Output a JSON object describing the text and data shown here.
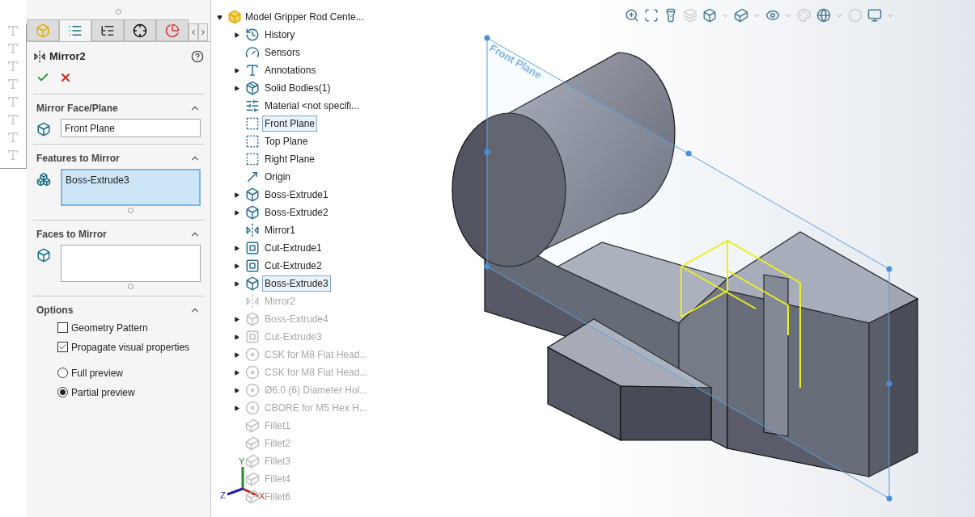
{
  "property_manager": {
    "tabs": [
      {
        "kind": "part",
        "selected": false
      },
      {
        "kind": "properties",
        "selected": true
      },
      {
        "kind": "configurations",
        "selected": false
      },
      {
        "kind": "dimensions",
        "selected": false
      },
      {
        "kind": "appearance",
        "selected": false
      }
    ],
    "title": "Mirror2",
    "sections": [
      {
        "title": "Mirror Face/Plane",
        "expanded": true,
        "kind": "plane",
        "value": "Front Plane",
        "active": false
      },
      {
        "title": "Features to Mirror",
        "expanded": true,
        "kind": "features",
        "value": "Boss-Extrude3",
        "active": true
      },
      {
        "title": "Faces to Mirror",
        "expanded": true,
        "kind": "faces",
        "active": false
      }
    ],
    "options": {
      "title": "Options",
      "expanded": true,
      "checkboxes": [
        {
          "label": "Geometry Pattern",
          "checked": false
        },
        {
          "label": "Propagate visual properties",
          "checked": true
        }
      ],
      "radios": [
        {
          "label": "Full preview",
          "selected": false
        },
        {
          "label": "Partial preview",
          "selected": true
        }
      ]
    }
  },
  "feature_tree": {
    "label": "Model Gripper Rod Cente...",
    "expanded": true,
    "children": [
      {
        "label": "History",
        "kind": "history",
        "expandable": true,
        "selected": false,
        "greyed": false
      },
      {
        "label": "Sensors",
        "kind": "sensors",
        "expandable": false,
        "selected": false,
        "greyed": false
      },
      {
        "label": "Annotations",
        "kind": "annotations",
        "expandable": true,
        "selected": false,
        "greyed": false
      },
      {
        "label": "Solid Bodies(1)",
        "kind": "bodies",
        "expandable": true,
        "selected": false,
        "greyed": false
      },
      {
        "label": "Material <not specifi...",
        "kind": "material",
        "expandable": false,
        "selected": false,
        "greyed": false
      },
      {
        "label": "Front Plane",
        "kind": "plane",
        "expandable": false,
        "selected": true,
        "greyed": false
      },
      {
        "label": "Top Plane",
        "kind": "plane",
        "expandable": false,
        "selected": false,
        "greyed": false
      },
      {
        "label": "Right Plane",
        "kind": "plane",
        "expandable": false,
        "selected": false,
        "greyed": false
      },
      {
        "label": "Origin",
        "kind": "origin",
        "expandable": false,
        "selected": false,
        "greyed": false
      },
      {
        "label": "Boss-Extrude1",
        "kind": "boss",
        "expandable": true,
        "selected": false,
        "greyed": false
      },
      {
        "label": "Boss-Extrude2",
        "kind": "boss",
        "expandable": true,
        "selected": false,
        "greyed": false
      },
      {
        "label": "Mirror1",
        "kind": "mirror",
        "expandable": false,
        "selected": false,
        "greyed": false
      },
      {
        "label": "Cut-Extrude1",
        "kind": "cut",
        "expandable": true,
        "selected": false,
        "greyed": false
      },
      {
        "label": "Cut-Extrude2",
        "kind": "cut",
        "expandable": true,
        "selected": false,
        "greyed": false
      },
      {
        "label": "Boss-Extrude3",
        "kind": "boss",
        "expandable": true,
        "selected": true,
        "greyed": false
      },
      {
        "label": "Mirror2",
        "kind": "mirror",
        "expandable": false,
        "selected": false,
        "greyed": true
      },
      {
        "label": "Boss-Extrude4",
        "kind": "boss",
        "expandable": true,
        "selected": false,
        "greyed": true
      },
      {
        "label": "Cut-Extrude3",
        "kind": "cut",
        "expandable": true,
        "selected": false,
        "greyed": true
      },
      {
        "label": "CSK for M8 Flat Head...",
        "kind": "hole",
        "expandable": true,
        "selected": false,
        "greyed": true
      },
      {
        "label": "CSK for M8 Flat Head...",
        "kind": "hole",
        "expandable": true,
        "selected": false,
        "greyed": true
      },
      {
        "label": "Ø6.0 (6) Diameter Hol...",
        "kind": "hole",
        "expandable": true,
        "selected": false,
        "greyed": true
      },
      {
        "label": "CBORE for M5 Hex H...",
        "kind": "hole",
        "expandable": true,
        "selected": false,
        "greyed": true
      },
      {
        "label": "Fillet1",
        "kind": "fillet",
        "expandable": false,
        "selected": false,
        "greyed": true
      },
      {
        "label": "Fillet2",
        "kind": "fillet",
        "expandable": false,
        "selected": false,
        "greyed": true
      },
      {
        "label": "Fillet3",
        "kind": "fillet",
        "expandable": false,
        "selected": false,
        "greyed": true
      },
      {
        "label": "Fillet4",
        "kind": "fillet",
        "expandable": false,
        "selected": false,
        "greyed": true
      },
      {
        "label": "Fillet6",
        "kind": "fillet",
        "expandable": false,
        "selected": false,
        "greyed": true
      }
    ]
  },
  "viewport": {
    "plane_label": "Front Plane",
    "axes": [
      "X",
      "Y",
      "Z"
    ]
  }
}
